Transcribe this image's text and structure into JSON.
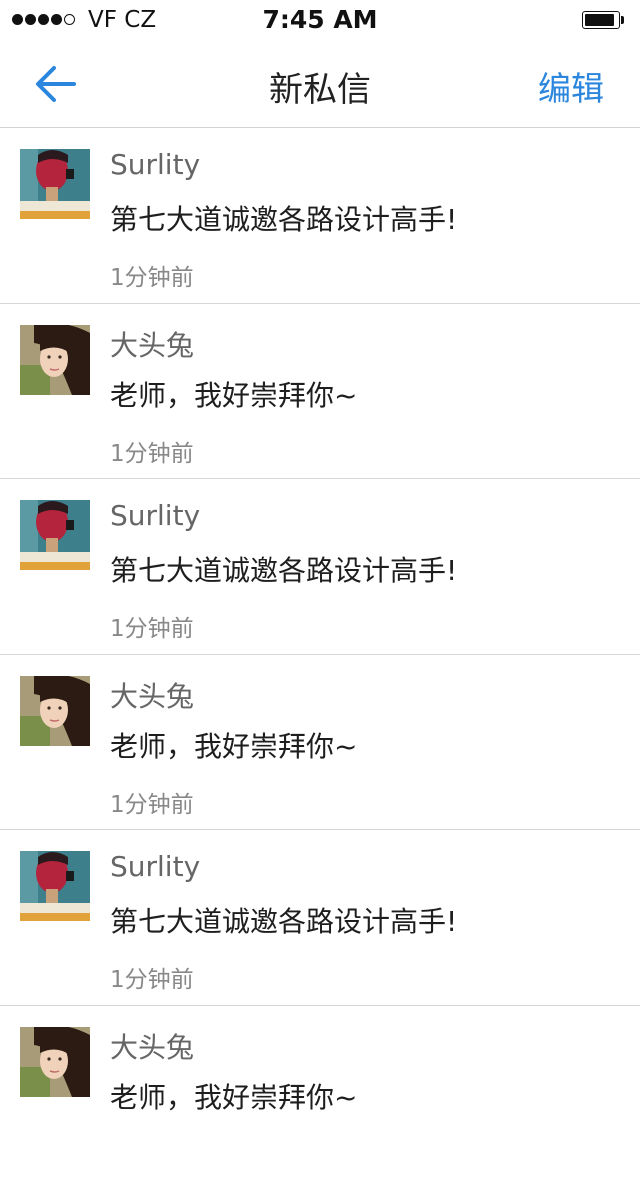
{
  "status_bar": {
    "carrier": "VF CZ",
    "time": "7:45 AM",
    "signal_bars_filled": 4,
    "signal_bars_total": 5,
    "battery_level": 0.9
  },
  "nav": {
    "back_icon": "arrow-left-icon",
    "title": "新私信",
    "edit_label": "编辑"
  },
  "colors": {
    "accent": "#2b86dd",
    "divider": "#d8d8d8",
    "sender_text": "#666666",
    "time_text": "#888888"
  },
  "messages": [
    {
      "sender": "Surlity",
      "text": "第七大道诚邀各路设计高手!",
      "time": "1分钟前",
      "avatar": "photo-avatar-red-portrait"
    },
    {
      "sender": "大头兔",
      "text": "老师，我好崇拜你~",
      "time": "1分钟前",
      "avatar": "photo-avatar-girl-portrait"
    },
    {
      "sender": "Surlity",
      "text": "第七大道诚邀各路设计高手!",
      "time": "1分钟前",
      "avatar": "photo-avatar-red-portrait"
    },
    {
      "sender": "大头兔",
      "text": "老师，我好崇拜你~",
      "time": "1分钟前",
      "avatar": "photo-avatar-girl-portrait"
    },
    {
      "sender": "Surlity",
      "text": "第七大道诚邀各路设计高手!",
      "time": "1分钟前",
      "avatar": "photo-avatar-red-portrait"
    },
    {
      "sender": "大头兔",
      "text": "老师，我好崇拜你~",
      "time": null,
      "avatar": "photo-avatar-girl-portrait"
    }
  ]
}
